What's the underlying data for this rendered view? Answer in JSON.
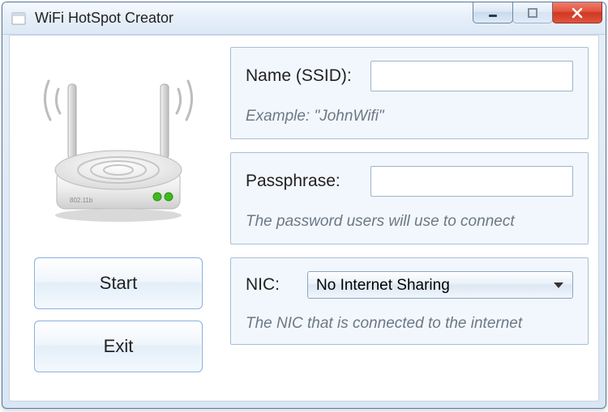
{
  "window": {
    "title": "WiFi HotSpot Creator"
  },
  "left": {
    "start_label": "Start",
    "exit_label": "Exit"
  },
  "ssid": {
    "label": "Name (SSID):",
    "value": "",
    "hint": "Example: \"JohnWifi\""
  },
  "pass": {
    "label": "Passphrase:",
    "value": "",
    "hint": "The password users will use to connect"
  },
  "nic": {
    "label": "NIC:",
    "selected": "No Internet Sharing",
    "hint": "The NIC that is connected to the internet"
  }
}
